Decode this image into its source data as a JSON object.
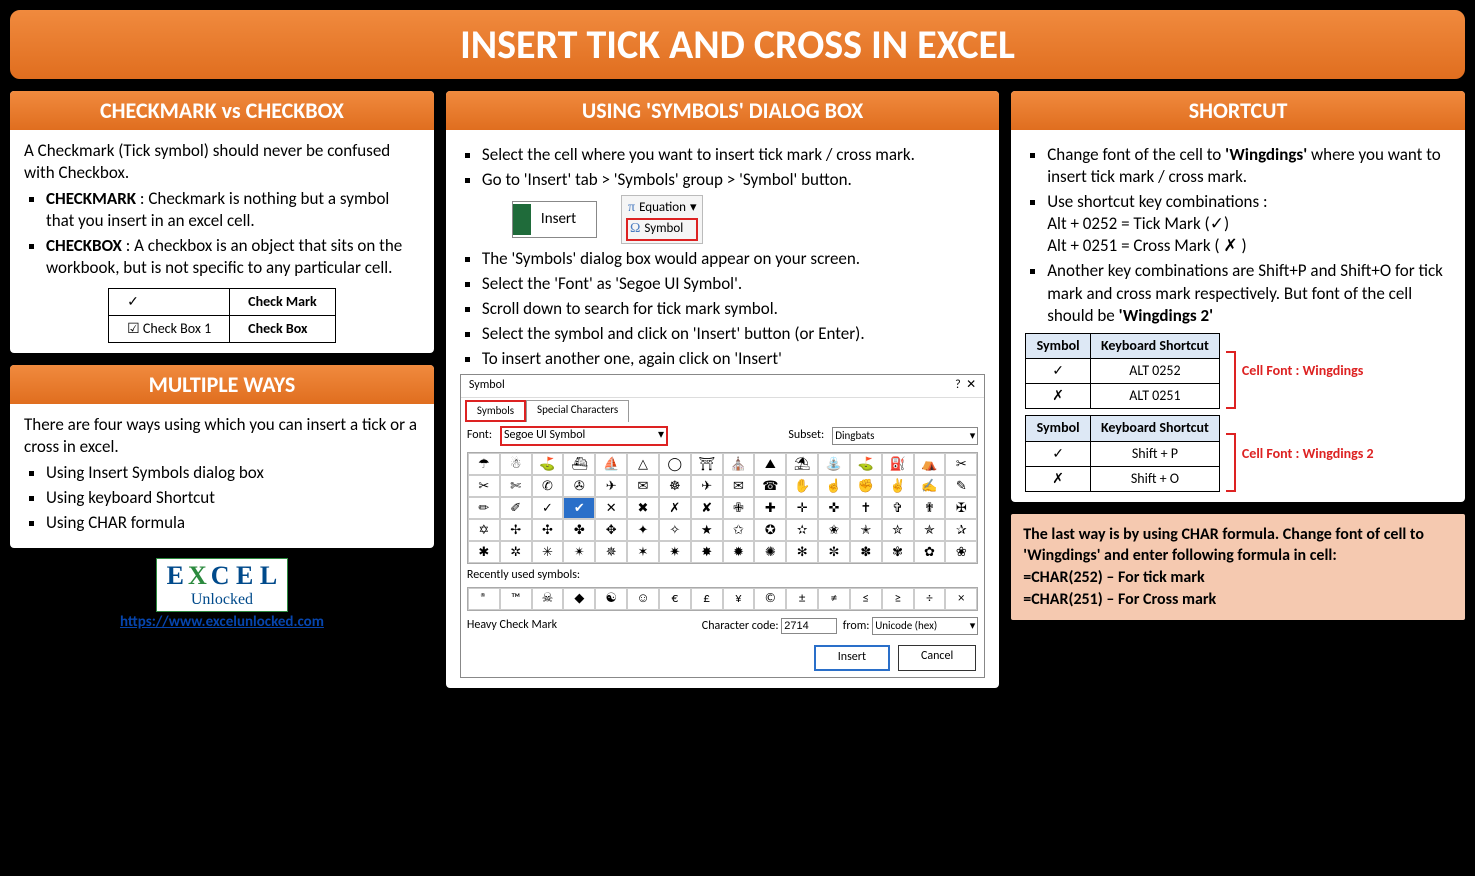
{
  "title": "INSERT TICK AND CROSS IN EXCEL",
  "left": {
    "panel1": {
      "header": "CHECKMARK vs CHECKBOX",
      "intro": "A Checkmark (Tick symbol) should never be confused with Checkbox.",
      "b1_label": "CHECKMARK",
      "b1_text": " : Checkmark is nothing but a symbol that you insert in an excel cell.",
      "b2_label": "CHECKBOX",
      "b2_text": " : A checkbox is an object that sits on the workbook, but is not specific to any particular cell.",
      "table": {
        "r1c1": "✓",
        "r1c2": "Check Mark",
        "r2c1": "☑ Check Box 1",
        "r2c2": "Check Box"
      }
    },
    "panel2": {
      "header": "MULTIPLE WAYS",
      "intro": "There are four ways using which you can insert a tick or a cross in excel.",
      "items": [
        "Using Insert Symbols dialog box",
        "Using keyboard Shortcut",
        "Using CHAR formula"
      ]
    },
    "logo": {
      "top": "E  X C E L",
      "bottom": "Unlocked",
      "url": "https://www.excelunlocked.com"
    }
  },
  "mid": {
    "header": "USING 'SYMBOLS' DIALOG BOX",
    "items": [
      "Select the cell where you want to insert tick mark / cross mark.",
      "Go to 'Insert' tab > 'Symbols' group > 'Symbol' button.",
      "The 'Symbols' dialog box would appear on your screen.",
      "Select the 'Font' as 'Segoe UI Symbol'.",
      "Scroll down to search for tick mark symbol.",
      "Select the symbol and click on 'Insert' button (or Enter).",
      "To insert another one, again click on 'Insert'"
    ],
    "insert_btn": "Insert",
    "equation": "Equation",
    "symbol": "Symbol",
    "dialog": {
      "title": "Symbol",
      "tab1": "Symbols",
      "tab2": "Special Characters",
      "font_label": "Font:",
      "font_value": "Segoe UI Symbol",
      "subset_label": "Subset:",
      "subset_value": "Dingbats",
      "recent_label": "Recently used symbols:",
      "name": "Heavy Check Mark",
      "code_label": "Character code:",
      "code_value": "2714",
      "from_label": "from:",
      "from_value": "Unicode (hex)",
      "insert": "Insert",
      "cancel": "Cancel",
      "grid": [
        "☂",
        "☃",
        "⛳",
        "⛴",
        "⛵",
        "△",
        "◯",
        "⛩",
        "⛪",
        "⛰",
        "⛱",
        "⛲",
        "⛳",
        "⛽",
        "⛺",
        "✂",
        "✂",
        "✄",
        "✆",
        "✇",
        "✈",
        "✉",
        "☸",
        "✈",
        "✉",
        "☎",
        "✋",
        "☝",
        "✊",
        "✌",
        "✍",
        "✎",
        "✏",
        "✐",
        "✓",
        "✔",
        "✕",
        "✖",
        "✗",
        "✘",
        "✙",
        "✚",
        "✛",
        "✜",
        "✝",
        "✞",
        "✟",
        "✠",
        "✡",
        "✢",
        "✣",
        "✤",
        "✥",
        "✦",
        "✧",
        "★",
        "✩",
        "✪",
        "✫",
        "✬",
        "✭",
        "✮",
        "✯",
        "✰",
        "✱",
        "✲",
        "✳",
        "✴",
        "✵",
        "✶",
        "✷",
        "✸",
        "✹",
        "✺",
        "✻",
        "✼",
        "✽",
        "✾",
        "✿",
        "❀"
      ],
      "recent": [
        "®",
        "™",
        "☠",
        "◆",
        "☯",
        "☺",
        "€",
        "£",
        "¥",
        "©",
        "±",
        "≠",
        "≤",
        "≥",
        "÷",
        "×"
      ]
    }
  },
  "right": {
    "header": "SHORTCUT",
    "b1a": "Change font of the cell to ",
    "b1b": "'Wingdings'",
    "b1c": " where you want to insert tick mark / cross mark.",
    "b2": "Use shortcut key combinations :",
    "b2l1": "Alt + 0252 = Tick Mark (✓)",
    "b2l2": "Alt + 0251 = Cross Mark ( ✗ )",
    "b3a": "Another key combinations are Shift+P and Shift+O for tick mark and cross mark respectively. But font of the cell should be ",
    "b3b": "'Wingdings 2'",
    "t1": {
      "h1": "Symbol",
      "h2": "Keyboard Shortcut",
      "r1c1": "✓",
      "r1c2": "ALT 0252",
      "r2c1": "✗",
      "r2c2": "ALT 0251",
      "label": "Cell Font : Wingdings"
    },
    "t2": {
      "h1": "Symbol",
      "h2": "Keyboard Shortcut",
      "r1c1": "✓",
      "r1c2": "Shift + P",
      "r2c1": "✗",
      "r2c2": "Shift + O",
      "label": "Cell Font : Wingdings 2"
    },
    "char": {
      "l1": "The last way is by using CHAR formula. Change font of cell to 'Wingdings' and enter following formula in cell:",
      "l2": "=CHAR(252) – For tick mark",
      "l3": "=CHAR(251) – For Cross mark"
    }
  }
}
